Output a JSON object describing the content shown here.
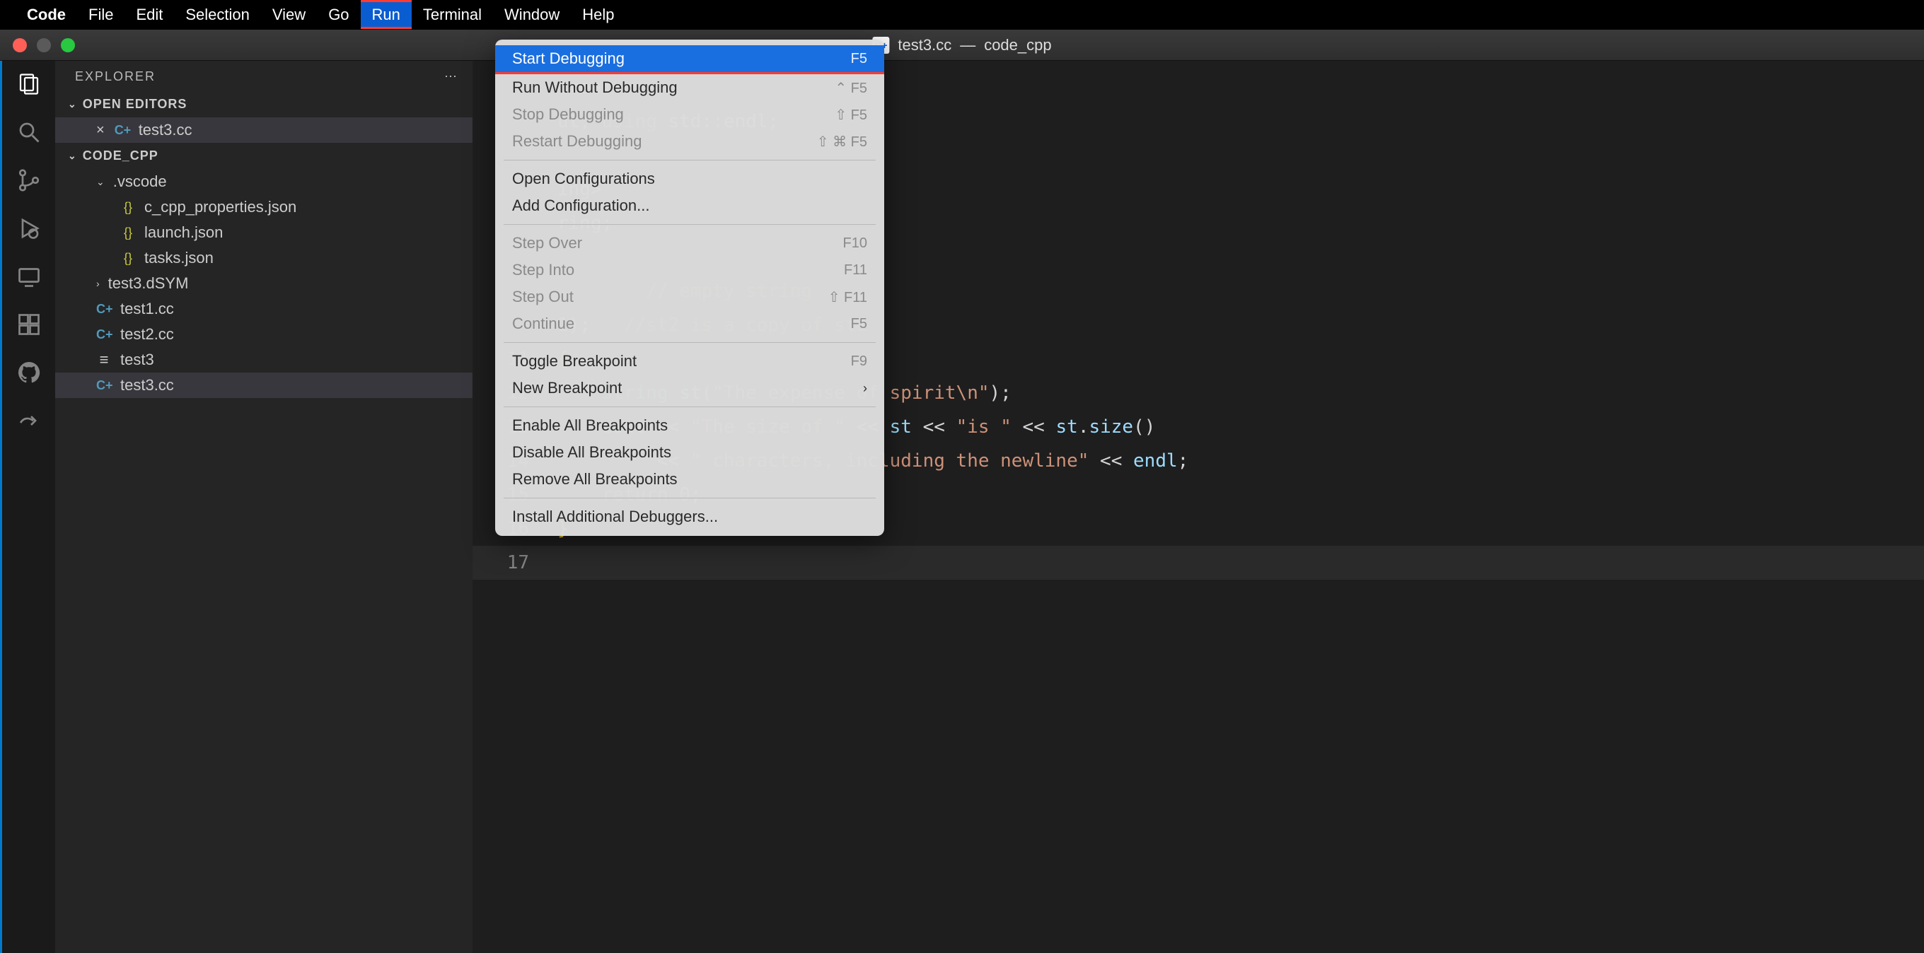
{
  "menubar": {
    "app": "Code",
    "items": [
      "File",
      "Edit",
      "Selection",
      "View",
      "Go",
      "Run",
      "Terminal",
      "Window",
      "Help"
    ],
    "active_index": 5
  },
  "titlebar": {
    "filename": "test3.cc",
    "project": "code_cpp"
  },
  "sidebar": {
    "title": "EXPLORER",
    "open_editors_label": "OPEN EDITORS",
    "open_editors": [
      {
        "name": "test3.cc",
        "icon": "cpp"
      }
    ],
    "project_label": "CODE_CPP",
    "tree": [
      {
        "name": ".vscode",
        "type": "folder",
        "open": true,
        "depth": 1
      },
      {
        "name": "c_cpp_properties.json",
        "type": "json",
        "depth": 2
      },
      {
        "name": "launch.json",
        "type": "json",
        "depth": 2
      },
      {
        "name": "tasks.json",
        "type": "json",
        "depth": 2
      },
      {
        "name": "test3.dSYM",
        "type": "folder",
        "open": false,
        "depth": 1
      },
      {
        "name": "test1.cc",
        "type": "cpp",
        "depth": 1
      },
      {
        "name": "test2.cc",
        "type": "cpp",
        "depth": 1
      },
      {
        "name": "test3",
        "type": "bin",
        "depth": 1
      },
      {
        "name": "test3.cc",
        "type": "cpp",
        "depth": 1,
        "selected": true
      }
    ]
  },
  "dropdown": {
    "groups": [
      [
        {
          "label": "Start Debugging",
          "shortcut": "F5",
          "highlighted": true
        },
        {
          "label": "Run Without Debugging",
          "shortcut": "⌃ F5"
        },
        {
          "label": "Stop Debugging",
          "shortcut": "⇧ F5",
          "disabled": true
        },
        {
          "label": "Restart Debugging",
          "shortcut": "⇧ ⌘ F5",
          "disabled": true
        }
      ],
      [
        {
          "label": "Open Configurations"
        },
        {
          "label": "Add Configuration..."
        }
      ],
      [
        {
          "label": "Step Over",
          "shortcut": "F10",
          "disabled": true
        },
        {
          "label": "Step Into",
          "shortcut": "F11",
          "disabled": true
        },
        {
          "label": "Step Out",
          "shortcut": "⇧ F11",
          "disabled": true
        },
        {
          "label": "Continue",
          "shortcut": "F5",
          "disabled": true
        }
      ],
      [
        {
          "label": "Toggle Breakpoint",
          "shortcut": "F9"
        },
        {
          "label": "New Breakpoint",
          "submenu": true
        }
      ],
      [
        {
          "label": "Enable All Breakpoints"
        },
        {
          "label": "Disable All Breakpoints"
        },
        {
          "label": "Remove All Breakpoints"
        }
      ],
      [
        {
          "label": "Install Additional Debuggers..."
        }
      ]
    ]
  },
  "editor": {
    "lines": [
      {
        "n": "",
        "visible_fragment_html": "tream>"
      },
      {
        "n": "",
        "visible_fragment_html": "ut; <span class='kw'>using</span> std<span class='punc'>::</span>endl;"
      },
      {
        "n": "",
        "visible_fragment_html": ""
      },
      {
        "n": "",
        "visible_fragment_html": "ing>"
      },
      {
        "n": "",
        "visible_fragment_html": "ring;"
      },
      {
        "n": "",
        "visible_fragment_html": ""
      },
      {
        "n": "",
        "visible_fragment_html": "        <span class='comment'>// empty string</span>"
      },
      {
        "n": "",
        "visible_fragment_html": "1<span class='punc'>);</span>   <span class='comment'>//st2 is a copy of st1</span>"
      },
      {
        "n": "11",
        "html": "<span class='brace'>{</span>"
      },
      {
        "n": "12",
        "html": "    <span class='type'>string</span> <span class='ident'>st</span><span class='punc'>(</span><span class='str'>\"The expense of spirit\\n\"</span><span class='punc'>);</span>"
      },
      {
        "n": "13",
        "html": "    <span class='ident'>cout</span> <span class='op'>&lt;&lt;</span> <span class='str'>\"The size of \"</span> <span class='op'>&lt;&lt;</span> <span class='ident'>st</span> <span class='op'>&lt;&lt;</span> <span class='str'>\"is \"</span> <span class='op'>&lt;&lt;</span> <span class='ident'>st</span><span class='punc'>.</span><span class='ident'>size</span><span class='punc'>()</span>"
      },
      {
        "n": "14",
        "html": "         <span class='op'>&lt;&lt;</span> <span class='str'>\" characters, including the newline\"</span> <span class='op'>&lt;&lt;</span> <span class='ident'>endl</span><span class='punc'>;</span>"
      },
      {
        "n": "15",
        "html": "    <span class='kw'>return</span> <span class='num'>0</span><span class='punc'>;</span>"
      },
      {
        "n": "16",
        "html": "<span class='brace'>}</span>"
      },
      {
        "n": "17",
        "html": "",
        "last": true
      }
    ]
  }
}
